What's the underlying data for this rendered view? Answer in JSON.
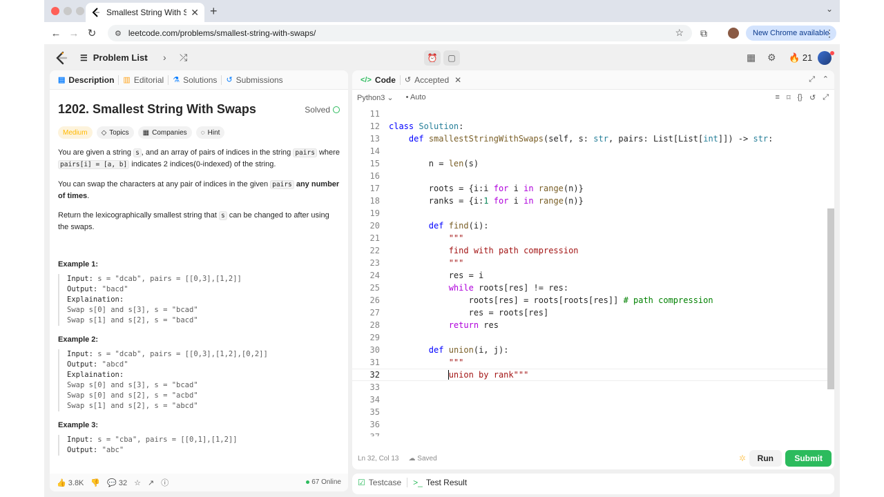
{
  "browser": {
    "tab_title": "Smallest String With Swaps -",
    "url": "leetcode.com/problems/smallest-string-with-swaps/",
    "update_label": "New Chrome available"
  },
  "nav": {
    "problem_list": "Problem List",
    "streak": "21"
  },
  "left_tabs": [
    {
      "label": "Description"
    },
    {
      "label": "Editorial"
    },
    {
      "label": "Solutions"
    },
    {
      "label": "Submissions"
    }
  ],
  "problem": {
    "title": "1202. Smallest String With Swaps",
    "status": "Solved",
    "difficulty": "Medium",
    "tags": [
      "Topics",
      "Companies",
      "Hint"
    ],
    "p1_a": "You are given a string ",
    "p1_code1": "s",
    "p1_b": ", and an array of pairs of indices in the string ",
    "p1_code2": "pairs",
    "p1_c": " where ",
    "p1_code3": "pairs[i] = [a, b]",
    "p1_d": " indicates 2 indices(0-indexed) of the string.",
    "p2_a": "You can swap the characters at any pair of indices in the given ",
    "p2_code": "pairs",
    "p2_bold": " any number of times",
    "p2_end": ".",
    "p3_a": "Return the lexicographically smallest string that ",
    "p3_code": "s",
    "p3_b": " can be changed to after using the swaps.",
    "examples": [
      {
        "title": "Example 1:",
        "lines": [
          {
            "label": "Input:",
            "text": " s = \"dcab\", pairs = [[0,3],[1,2]]"
          },
          {
            "label": "Output:",
            "text": " \"bacd\""
          },
          {
            "label": "Explaination:",
            "text": ""
          },
          {
            "label": "",
            "text": "Swap s[0] and s[3], s = \"bcad\""
          },
          {
            "label": "",
            "text": "Swap s[1] and s[2], s = \"bacd\""
          }
        ]
      },
      {
        "title": "Example 2:",
        "lines": [
          {
            "label": "Input:",
            "text": " s = \"dcab\", pairs = [[0,3],[1,2],[0,2]]"
          },
          {
            "label": "Output:",
            "text": " \"abcd\""
          },
          {
            "label": "Explaination:",
            "text": ""
          },
          {
            "label": "",
            "text": "Swap s[0] and s[3], s = \"bcad\""
          },
          {
            "label": "",
            "text": "Swap s[0] and s[2], s = \"acbd\""
          },
          {
            "label": "",
            "text": "Swap s[1] and s[2], s = \"abcd\""
          }
        ]
      },
      {
        "title": "Example 3:",
        "lines": [
          {
            "label": "Input:",
            "text": " s = \"cba\", pairs = [[0,1],[1,2]]"
          },
          {
            "label": "Output:",
            "text": " \"abc\""
          }
        ]
      }
    ],
    "likes": "3.8K",
    "comments": "32",
    "online": "67 Online"
  },
  "code_tabs": {
    "code": "Code",
    "accepted": "Accepted"
  },
  "editor": {
    "language": "Python3",
    "mode": "Auto",
    "cursor": "Ln 32, Col 13",
    "saved": "Saved",
    "run": "Run",
    "submit": "Submit"
  },
  "bottom_tabs": {
    "testcase": "Testcase",
    "result": "Test Result"
  },
  "colors": {
    "accent_green": "#2cbb5d",
    "medium": "#ffb800"
  }
}
